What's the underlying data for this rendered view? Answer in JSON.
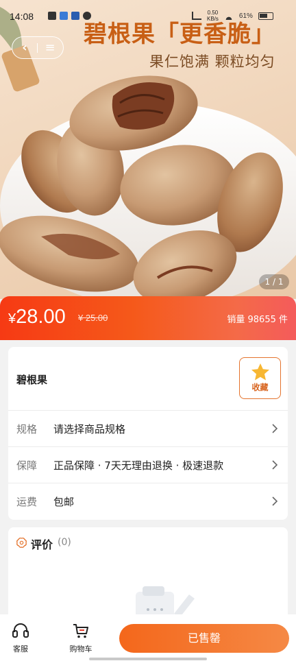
{
  "status_bar": {
    "time": "14:08",
    "net_speed_value": "0.50",
    "net_speed_unit": "KB/s",
    "battery": "61%"
  },
  "nav": {
    "back_icon": "chevron-left-icon",
    "menu_icon": "menu-icon"
  },
  "hero": {
    "title": "碧根果「更香脆」",
    "subtitle": "果仁饱满 颗粒均匀",
    "image_counter": "1 / 1"
  },
  "price": {
    "currency": "¥",
    "current": "28.00",
    "original": "¥ 25.00",
    "sales": "销量 98655 件"
  },
  "product": {
    "name": "碧根果",
    "favorite_label": "收藏"
  },
  "specs": [
    {
      "label": "规格",
      "value": "请选择商品规格"
    },
    {
      "label": "保障",
      "value": "正品保障 · 7天无理由退换 · 极速退款"
    },
    {
      "label": "运费",
      "value": "包邮"
    }
  ],
  "reviews": {
    "title": "评价",
    "count": "(0)"
  },
  "bottom_bar": {
    "service_label": "客服",
    "cart_label": "购物车",
    "sold_out_label": "已售罄"
  },
  "colors": {
    "accent": "#f4671b",
    "price_red": "#f63a14",
    "favorite_border": "#e4732c"
  }
}
